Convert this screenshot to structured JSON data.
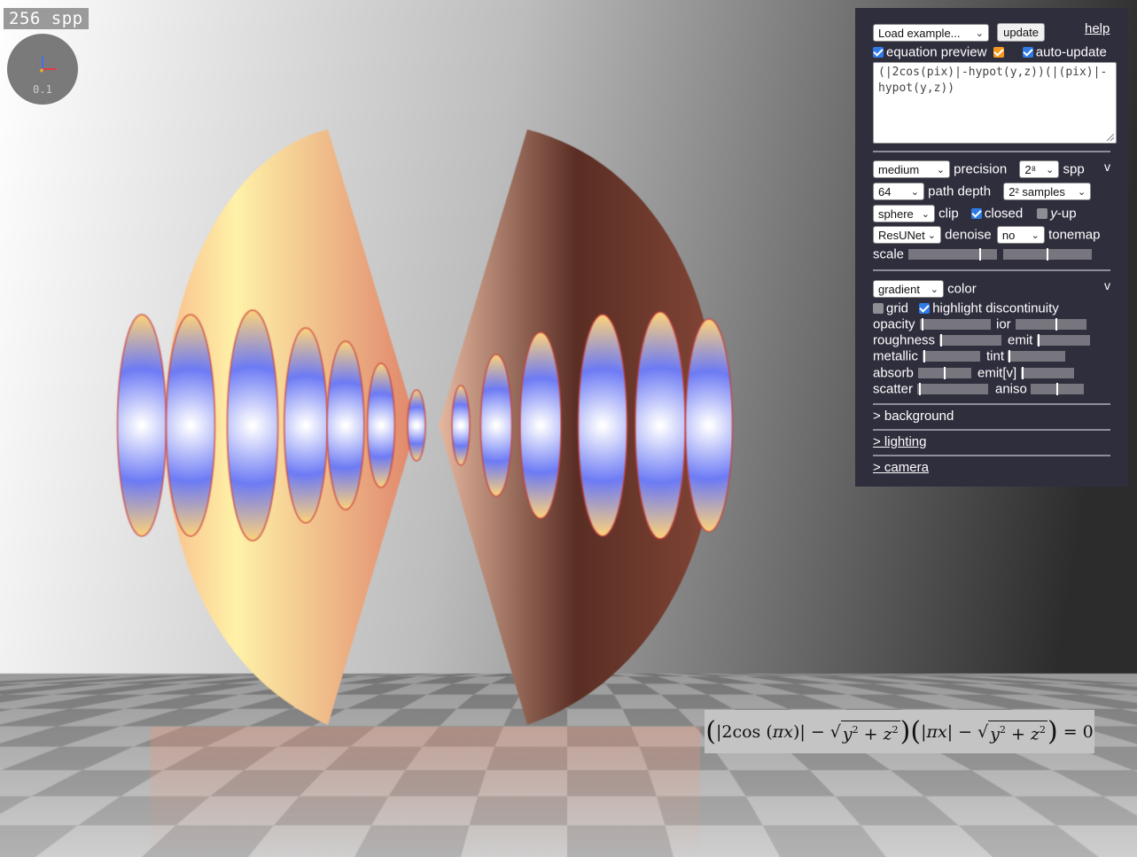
{
  "viewer": {
    "spp_badge": "256 spp",
    "axes_scale": "0.1",
    "axes_colors": {
      "x": "#e23b4a",
      "y": "#3a6ff0",
      "z": "#f2b21c"
    },
    "render_colors": {
      "floor_light": "#efefef",
      "floor_dark": "#3a3a3a",
      "shell_left": "#f59a7a",
      "shell_right": "#5a2e24",
      "ring_blue": "#6d7bf5",
      "ring_glow": "#ffd37a"
    }
  },
  "panel": {
    "load_example": "Load example...",
    "update_button": "update",
    "help_link": "help",
    "equation_preview_label": "equation preview",
    "equation_preview_checked": true,
    "equation_preview_extra_checked": true,
    "auto_update_label": "auto-update",
    "auto_update_checked": true,
    "equation_text": "(|2cos(pix)|-hypot(y,z))(|(pix)|-hypot(y,z))",
    "render_section": {
      "toggle": "v",
      "precision_value": "medium",
      "precision_label": "precision",
      "spp_value": "2⁸",
      "spp_label": "spp",
      "path_depth_value": "64",
      "path_depth_label": "path depth",
      "samples_value": "2² samples",
      "clip_value": "sphere",
      "clip_label": "clip",
      "closed_label": "closed",
      "closed_checked": true,
      "yup_label_italic": "y",
      "yup_label_rest": "-up",
      "yup_checked": false,
      "denoise_value": "ResUNet",
      "denoise_label": "denoise",
      "tonemap_value": "no",
      "tonemap_label": "tonemap",
      "scale_label": "scale",
      "scale_slider_1": 0.82,
      "scale_slider_2": 0.5
    },
    "material_section": {
      "toggle": "v",
      "color_value": "gradient",
      "color_label": "color",
      "grid_label": "grid",
      "grid_checked": false,
      "highlight_label": "highlight discontinuity",
      "highlight_checked": true,
      "opacity_label": "opacity",
      "opacity_value": 0.02,
      "ior_label": "ior",
      "ior_value": 0.58,
      "roughness_label": "roughness",
      "roughness_value": 0.02,
      "emit_label": "emit",
      "emit_value": 0.02,
      "metallic_label": "metallic",
      "metallic_value": 0.02,
      "tint_label": "tint",
      "tint_value": 0.02,
      "absorb_label": "absorb",
      "absorb_value": 0.5,
      "emitv_label": "emit[v]",
      "emitv_value": 0.02,
      "scatter_label": "scatter",
      "scatter_value": 0.02,
      "aniso_label": "aniso",
      "aniso_value": 0.5
    },
    "background_section": "> background",
    "lighting_section": "> lighting",
    "camera_section": "> camera"
  }
}
